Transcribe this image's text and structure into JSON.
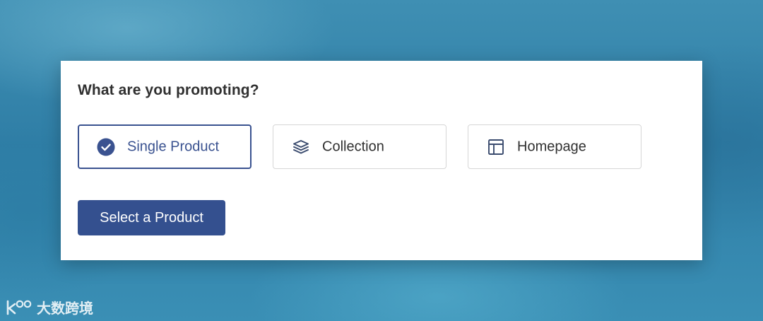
{
  "panel": {
    "question": "What are you promoting?",
    "options": [
      {
        "label": "Single Product",
        "icon": "checkmark-circle-icon",
        "selected": true
      },
      {
        "label": "Collection",
        "icon": "layers-stack-icon",
        "selected": false
      },
      {
        "label": "Homepage",
        "icon": "layout-page-icon",
        "selected": false
      }
    ],
    "primary_button": "Select a Product"
  },
  "colors": {
    "accent": "#34508f",
    "selected_border": "#3a5290",
    "text": "#303030",
    "border": "#d6d6d6",
    "card": "#ffffff"
  },
  "watermark": {
    "text": "大数跨境",
    "logo": "k100-logo"
  }
}
